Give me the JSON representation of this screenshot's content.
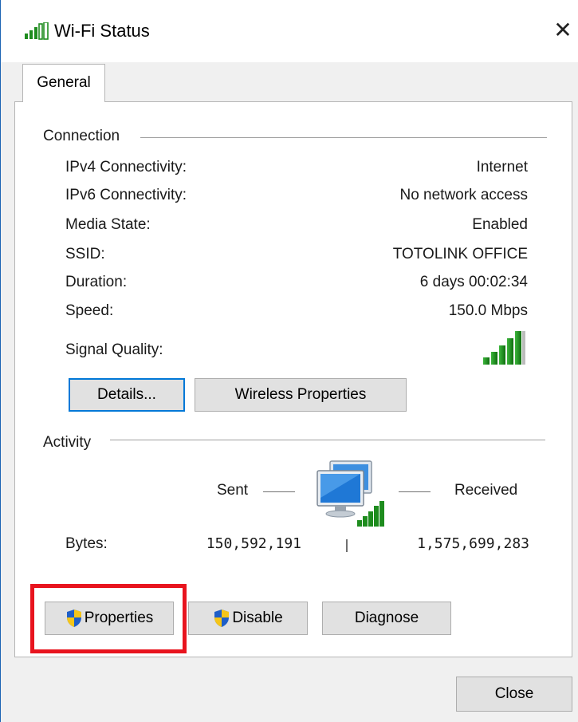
{
  "window": {
    "title": "Wi-Fi Status",
    "title_icon": "wifi-signal-icon",
    "close_icon": "close-icon",
    "close_glyph": "✕"
  },
  "tabs": [
    {
      "label": "General",
      "selected": true
    }
  ],
  "connection": {
    "label": "Connection",
    "rows": [
      {
        "label": "IPv4 Connectivity:",
        "value": "Internet"
      },
      {
        "label": "IPv6 Connectivity:",
        "value": "No network access"
      },
      {
        "label": "Media State:",
        "value": "Enabled"
      },
      {
        "label": "SSID:",
        "value": "TOTOLINK OFFICE"
      },
      {
        "label": "Duration:",
        "value": "6 days 00:02:34"
      },
      {
        "label": "Speed:",
        "value": "150.0 Mbps"
      }
    ],
    "signal_quality_label": "Signal Quality:",
    "signal_icon": "signal-bars-icon",
    "signal_bars_lit": 5,
    "signal_bars_total": 5,
    "details_button": "Details...",
    "wireless_properties_button": "Wireless Properties"
  },
  "activity": {
    "label": "Activity",
    "sent_label": "Sent",
    "received_label": "Received",
    "network_icon": "network-computers-icon",
    "bytes_label": "Bytes:",
    "bytes_sent": "150,592,191",
    "bytes_received": "1,575,699,283"
  },
  "buttons": {
    "properties": "Properties",
    "disable": "Disable",
    "diagnose": "Diagnose",
    "close": "Close",
    "shield_icon": "uac-shield-icon"
  },
  "colors": {
    "accent": "#0078d7",
    "highlight": "#e8141e",
    "signal_green": "#1e8c1e"
  }
}
